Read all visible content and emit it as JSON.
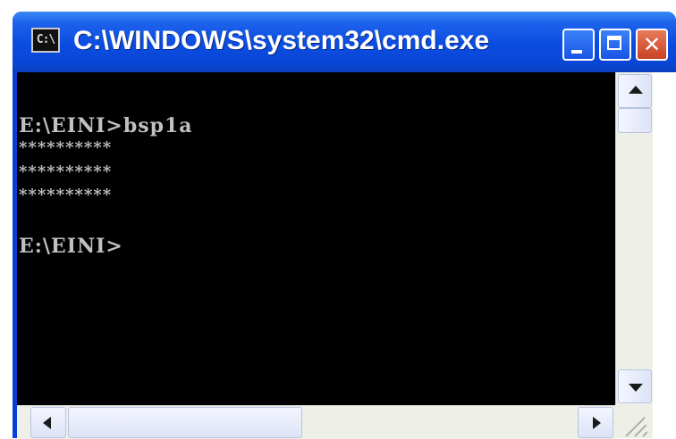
{
  "window": {
    "title": "C:\\WINDOWS\\system32\\cmd.exe",
    "icon_label": "C:\\",
    "icon": "cmd-icon",
    "controls": {
      "minimize": "minimize-icon",
      "maximize": "maximize-icon",
      "close": "close-icon",
      "close_glyph": "✕"
    }
  },
  "console": {
    "lines": [
      "E:\\EINI>bsp1a",
      "**********",
      "**********",
      "**********",
      "E:\\EINI>"
    ],
    "foreground": "#c0c0c0",
    "background": "#000000"
  },
  "colors": {
    "titlebar": "#0a4ce0",
    "close_button": "#c84324"
  }
}
